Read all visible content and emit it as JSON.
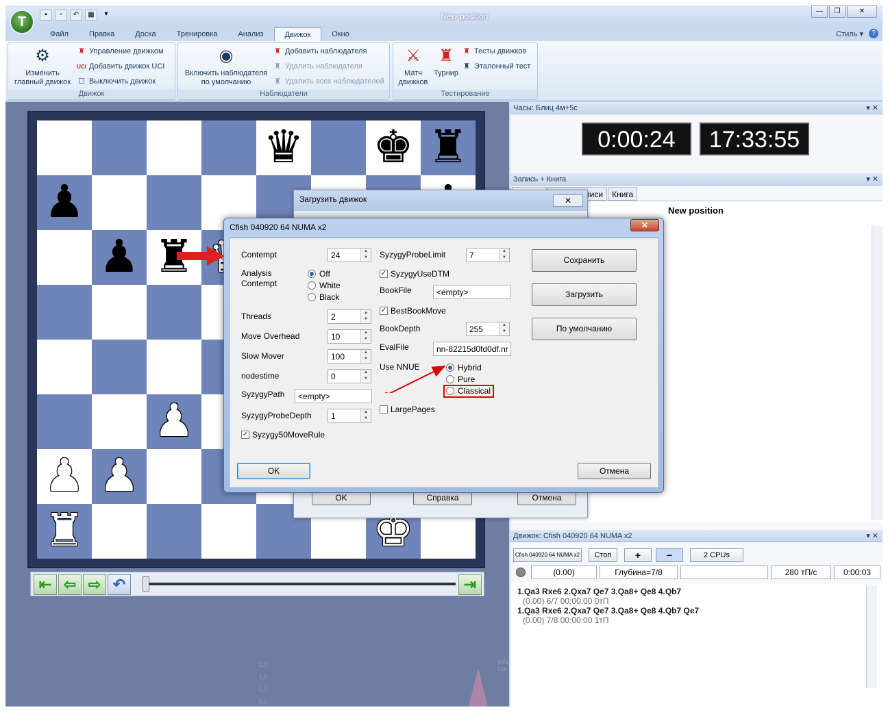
{
  "window": {
    "title": "New position",
    "min_icon": "minimize-icon",
    "max_icon": "restore-icon",
    "close_icon": "close-icon"
  },
  "app_orb": {
    "letter": "T"
  },
  "menu": {
    "tabs": [
      "Файл",
      "Правка",
      "Доска",
      "Тренировка",
      "Анализ",
      "Движок",
      "Окно"
    ],
    "active": "Движок",
    "style": "Стиль ▾"
  },
  "ribbon": {
    "engine_group": {
      "label": "Движок",
      "change_main": "Изменить главный движок",
      "manage": "Управление движком",
      "add_uci": "Добавить движок UCI",
      "disable": "Выключить движок"
    },
    "observers_group": {
      "label": "Наблюдатели",
      "enable_default": "Включить наблюдателя по умолчанию",
      "add": "Добавить наблюдателя",
      "remove": "Удалить наблюдателя",
      "remove_all": "Удалить всех наблюдателей"
    },
    "testing_group": {
      "label": "Тестирование",
      "match": "Матч движков",
      "tournament": "Турнир",
      "tests": "Тесты движков",
      "reference": "Эталонный тест"
    }
  },
  "board": {
    "squares": [
      [
        "",
        "",
        "",
        "",
        "♛",
        "",
        "♚",
        "♜"
      ],
      [
        "♟",
        "",
        "",
        "",
        "",
        "",
        "",
        "♟"
      ],
      [
        "",
        "♟",
        "♜",
        "♕",
        "",
        "",
        "",
        ""
      ],
      [
        "",
        "",
        "",
        "",
        "",
        "",
        "",
        ""
      ],
      [
        "",
        "",
        "",
        "",
        "",
        "",
        "",
        ""
      ],
      [
        "",
        "",
        "♙",
        "",
        "",
        "",
        "",
        ""
      ],
      [
        "♙",
        "♙",
        "",
        "",
        "",
        "",
        "",
        ""
      ],
      [
        "♖",
        "",
        "",
        "",
        "",
        "",
        "♔",
        ""
      ]
    ],
    "white_pieces": [
      "♔",
      "♕",
      "♖",
      "♗",
      "♘",
      "♙"
    ]
  },
  "graph": {
    "unit": "Мбит/сек",
    "y_labels": [
      "2,0",
      "1,5",
      "1,0",
      "0,5"
    ]
  },
  "clock_panel": {
    "title": "Часы: Блиц 4м+5с",
    "time1": "0:00:24",
    "time2": "17:33:55"
  },
  "notation_panel": {
    "title": "Запись + Книга",
    "tabs": [
      "Запись",
      "Бланк записи",
      "Книга"
    ],
    "heading": "New position"
  },
  "engine_panel": {
    "title": "Движок: Cfish 040920 64 NUMA x2",
    "engine_button": "Cfish 040920 64 NUMA x2",
    "stop": "Стоп",
    "cpus": "2 CPUs",
    "eval": "(0.00)",
    "depth": "Глубина=7/8",
    "speed": "280 тП/с",
    "time": "0:00:03",
    "lines": [
      {
        "main": "1.Qa3 Rxe6 2.Qxa7 Qe7 3.Qa8+ Qe8 4.Qb7",
        "sub": "(0.00)   6/7   00:00:00  0тП"
      },
      {
        "main": "1.Qa3 Rxe6 2.Qxa7 Qe7 3.Qa8+ Qe8 4.Qb7 Qe7",
        "sub": "(0.00)   7/8   00:00:00  1тП"
      }
    ]
  },
  "back_dialog": {
    "title": "Загрузить движок",
    "ok": "OK",
    "help": "Справка",
    "cancel": "Отмена"
  },
  "dialog": {
    "title": "Cfish 040920 64 NUMA x2",
    "contempt": {
      "label": "Contempt",
      "value": "24"
    },
    "analysis_contempt": {
      "label1": "Analysis",
      "label2": "Contempt",
      "options": [
        "Off",
        "White",
        "Black"
      ],
      "selected": "Off"
    },
    "threads": {
      "label": "Threads",
      "value": "2"
    },
    "move_overhead": {
      "label": "Move Overhead",
      "value": "10"
    },
    "slow_mover": {
      "label": "Slow Mover",
      "value": "100"
    },
    "nodestime": {
      "label": "nodestime",
      "value": "0"
    },
    "syzygy_path": {
      "label": "SyzygyPath",
      "value": "<empty>"
    },
    "syzygy_probe_depth": {
      "label": "SyzygyProbeDepth",
      "value": "1"
    },
    "syzygy_50": {
      "label": "Syzygy50MoveRule",
      "checked": true
    },
    "syzygy_probe_limit": {
      "label": "SyzygyProbeLimit",
      "value": "7"
    },
    "syzygy_use_dtm": {
      "label": "SyzygyUseDTM",
      "checked": true
    },
    "book_file": {
      "label": "BookFile",
      "value": "<empty>"
    },
    "best_book_move": {
      "label": "BestBookMove",
      "checked": true
    },
    "book_depth": {
      "label": "BookDepth",
      "value": "255"
    },
    "eval_file": {
      "label": "EvalFile",
      "value": "nn-82215d0fd0df.nr"
    },
    "use_nnue": {
      "label": "Use NNUE",
      "options": [
        "Hybrid",
        "Pure",
        "Classical"
      ],
      "selected": "Hybrid"
    },
    "large_pages": {
      "label": "LargePages",
      "checked": false
    },
    "buttons": {
      "save": "Сохранить",
      "load": "Загрузить",
      "default": "По умолчанию",
      "ok": "OK",
      "cancel": "Отмена"
    }
  },
  "colors": {
    "board_dark": "#6f84b9",
    "board_light": "#ffffff",
    "annotation_red": "#e00000",
    "nav_green": "#2b9b1b"
  }
}
